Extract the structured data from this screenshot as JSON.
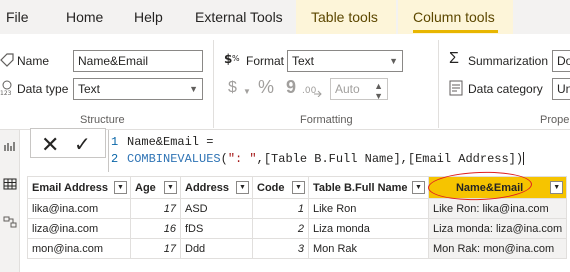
{
  "tabs": [
    {
      "label": "File",
      "active": false
    },
    {
      "label": "Home",
      "active": false
    },
    {
      "label": "Help",
      "active": false
    },
    {
      "label": "External Tools",
      "active": false
    },
    {
      "label": "Table tools",
      "active": false
    },
    {
      "label": "Column tools",
      "active": true
    }
  ],
  "structure": {
    "title": "Structure",
    "name_label": "Name",
    "name_value": "Name&Email",
    "datatype_label": "Data type",
    "datatype_value": "Text"
  },
  "formatting": {
    "title": "Formatting",
    "format_label": "Format",
    "format_value": "Text",
    "currency_symbol": "$",
    "percent_symbol": "%",
    "comma_symbol": "9",
    "decimals_value": "Auto"
  },
  "properties": {
    "title": "Proper",
    "summarization_label": "Summarization",
    "summarization_value": "Do",
    "datacategory_label": "Data category",
    "datacategory_value": "Un"
  },
  "formula": {
    "line1_num": "1",
    "line1_text": "Name&Email =",
    "line2_num": "2",
    "line2_fn": "COMBINEVALUES",
    "line2_open": "(",
    "line2_str": "\": \"",
    "line2_rest": ",[Table B.Full Name],[Email Address]",
    "line2_close": ")"
  },
  "table": {
    "headers": [
      "Email Address",
      "Age",
      "Address",
      "Code",
      "Table B.Full Name",
      "Name&Email"
    ],
    "rows": [
      [
        "lika@ina.com",
        "17",
        "ASD",
        "1",
        "Like Ron",
        "Like Ron: lika@ina.com"
      ],
      [
        "liza@ina.com",
        "16",
        "fDS",
        "2",
        "Liza monda",
        "Liza monda: liza@ina.com"
      ],
      [
        "mon@ina.com",
        "17",
        "Ddd",
        "3",
        "Mon Rak",
        "Mon Rak: mon@ina.com"
      ]
    ]
  },
  "colors": {
    "selected_header": "#f6c400",
    "tab_highlight": "#fdf5d9",
    "annotation_circle": "#e02020"
  }
}
